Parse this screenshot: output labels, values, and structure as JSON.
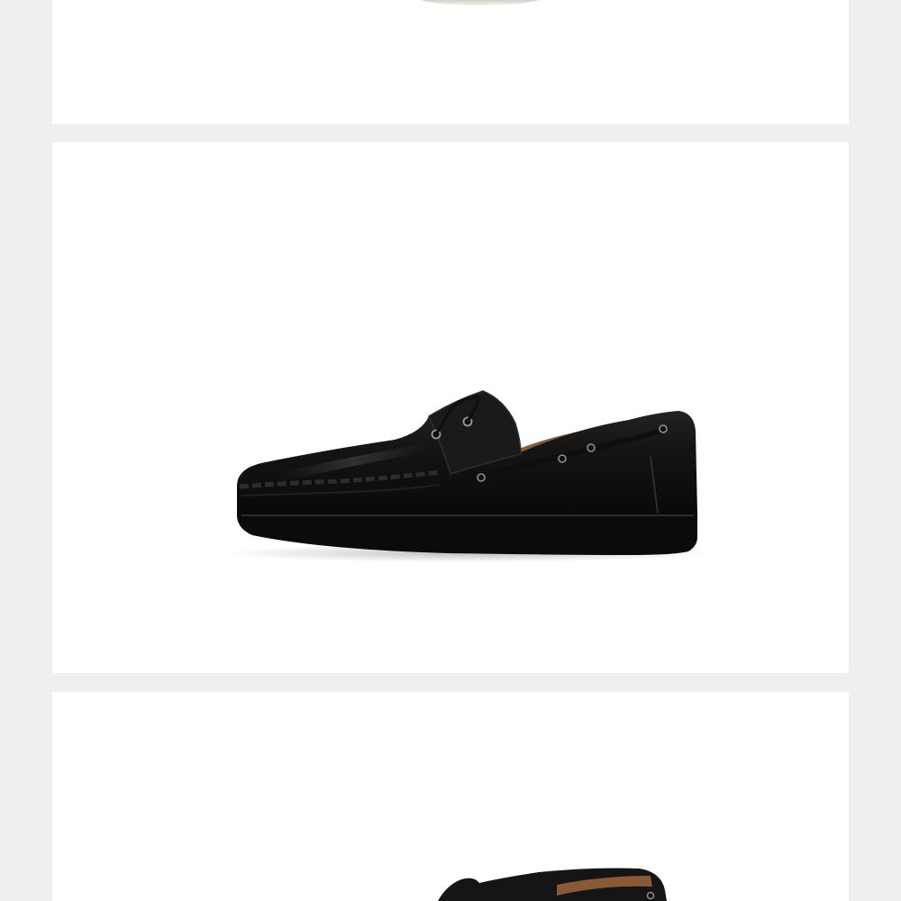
{
  "gallery": {
    "background_color": "#efefef",
    "panel_color": "#ffffff",
    "items": [
      {
        "subject": "shoe-sole-edge",
        "visibility": "partial-bottom"
      },
      {
        "subject": "black-leather-boat-shoe-side-view",
        "visibility": "full"
      },
      {
        "subject": "black-leather-boat-shoe-top",
        "visibility": "partial-top"
      }
    ]
  },
  "colors": {
    "leather": "#141414",
    "sole": "#0b0b0b",
    "lining": "#8a5a36",
    "eyelet": "#9a9a9a"
  }
}
